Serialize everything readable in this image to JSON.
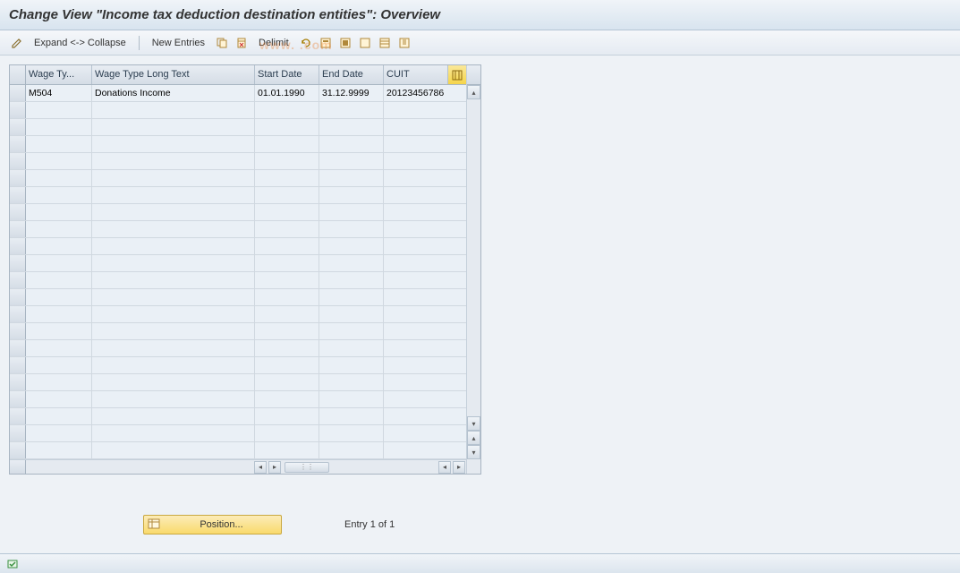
{
  "header": {
    "title": "Change View \"Income tax deduction destination entities\": Overview"
  },
  "toolbar": {
    "expand_collapse": "Expand <-> Collapse",
    "new_entries": "New Entries",
    "delimit": "Delimit",
    "icons": {
      "edit": "edit-icon",
      "copy": "copy-icon",
      "delete": "delete-icon",
      "undo": "undo-icon",
      "select_all": "select-all-icon",
      "deselect_all": "deselect-all-icon",
      "print": "print-icon",
      "config": "config-icon"
    }
  },
  "table": {
    "columns": {
      "wage_type": "Wage Ty...",
      "long_text": "Wage Type Long Text",
      "start_date": "Start Date",
      "end_date": "End Date",
      "cuit": "CUIT"
    },
    "rows": [
      {
        "wage_type": "M504",
        "long_text": "Donations Income",
        "start_date": "01.01.1990",
        "end_date": "31.12.9999",
        "cuit": "20123456786"
      }
    ],
    "empty_rows": 21
  },
  "footer": {
    "position_label": "Position...",
    "entry_text": "Entry 1 of 1"
  },
  "watermark": "www.               .com"
}
